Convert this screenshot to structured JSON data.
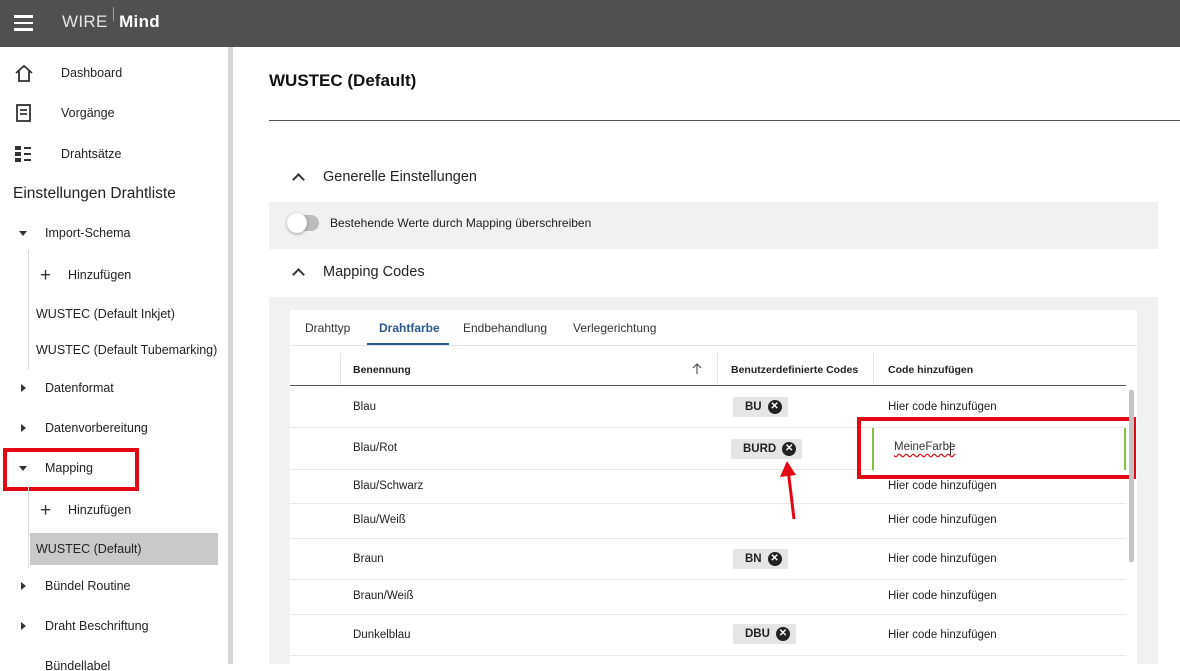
{
  "topbar": {
    "logo_part1": "WIRE",
    "logo_part2": "Mind"
  },
  "sidebar": {
    "nav": [
      {
        "label": "Dashboard",
        "icon": "home-icon"
      },
      {
        "label": "Vorgänge",
        "icon": "document-icon"
      },
      {
        "label": "Drahtsätze",
        "icon": "list-icon"
      }
    ],
    "section_title": "Einstellungen Drahtliste",
    "tree": {
      "import_schema": "Import-Schema",
      "import_add": "Hinzufügen",
      "import_items": [
        "WUSTEC (Default Inkjet)",
        "WUSTEC (Default Tubemarking)"
      ],
      "datenformat": "Datenformat",
      "datenvorbereitung": "Datenvorbereitung",
      "mapping": "Mapping",
      "mapping_add": "Hinzufügen",
      "mapping_selected": "WUSTEC (Default)",
      "buendel_routine": "Bündel Routine",
      "draht_beschriftung": "Draht Beschriftung",
      "buendel_cut": "Bündellabel"
    }
  },
  "main": {
    "title": "WUSTEC (Default)",
    "general": {
      "heading": "Generelle Einstellungen",
      "toggle_label": "Bestehende Werte durch Mapping überschreiben",
      "toggle_on": false
    },
    "mapping": {
      "heading": "Mapping Codes",
      "tabs": [
        "Drahttyp",
        "Drahtfarbe",
        "Endbehandlung",
        "Verlegerichtung"
      ],
      "active_tab": "Drahtfarbe",
      "columns": [
        "Benennung",
        "Benutzerdefinierte Codes",
        "Code hinzufügen"
      ],
      "sort_icon": "arrow-up-icon",
      "rows": [
        {
          "name": "Blau",
          "code": "BU",
          "add": "Hier code hinzufügen"
        },
        {
          "name": "Blau/Rot",
          "code": "BURD",
          "add": "MeineFarbe"
        },
        {
          "name": "Blau/Schwarz",
          "code": "",
          "add": "Hier code hinzufügen"
        },
        {
          "name": "Blau/Weiß",
          "code": "",
          "add": "Hier code hinzufügen"
        },
        {
          "name": "Braun",
          "code": "BN",
          "add": "Hier code hinzufügen"
        },
        {
          "name": "Braun/Weiß",
          "code": "",
          "add": "Hier code hinzufügen"
        },
        {
          "name": "Dunkelblau",
          "code": "DBU",
          "add": "Hier code hinzufügen"
        }
      ]
    }
  },
  "colors": {
    "accent": "#2b5a8c",
    "highlight": "#e30613",
    "focus": "#7fc33f",
    "topbar": "#505050"
  }
}
